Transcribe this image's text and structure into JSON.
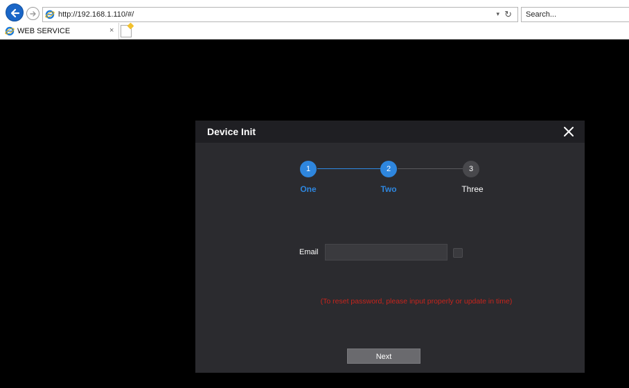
{
  "browser": {
    "url": "http://192.168.1.110/#/",
    "search_placeholder": "Search...",
    "tab_title": "WEB SERVICE",
    "tab_close": "×",
    "addr_dropdown": "▾",
    "addr_refresh": "↻"
  },
  "dialog": {
    "title": "Device Init",
    "close": "✕",
    "steps": [
      {
        "number": "1",
        "label": "One",
        "state": "done"
      },
      {
        "number": "2",
        "label": "Two",
        "state": "active"
      },
      {
        "number": "3",
        "label": "Three",
        "state": "pending"
      }
    ],
    "email_label": "Email",
    "email_value": "",
    "hint": "(To reset password, please input properly or update in time)",
    "next_label": "Next"
  },
  "colors": {
    "accent": "#2e86de",
    "hint": "#c8241c",
    "dialog_bg": "#2b2b2f",
    "page_bg": "#000000"
  }
}
